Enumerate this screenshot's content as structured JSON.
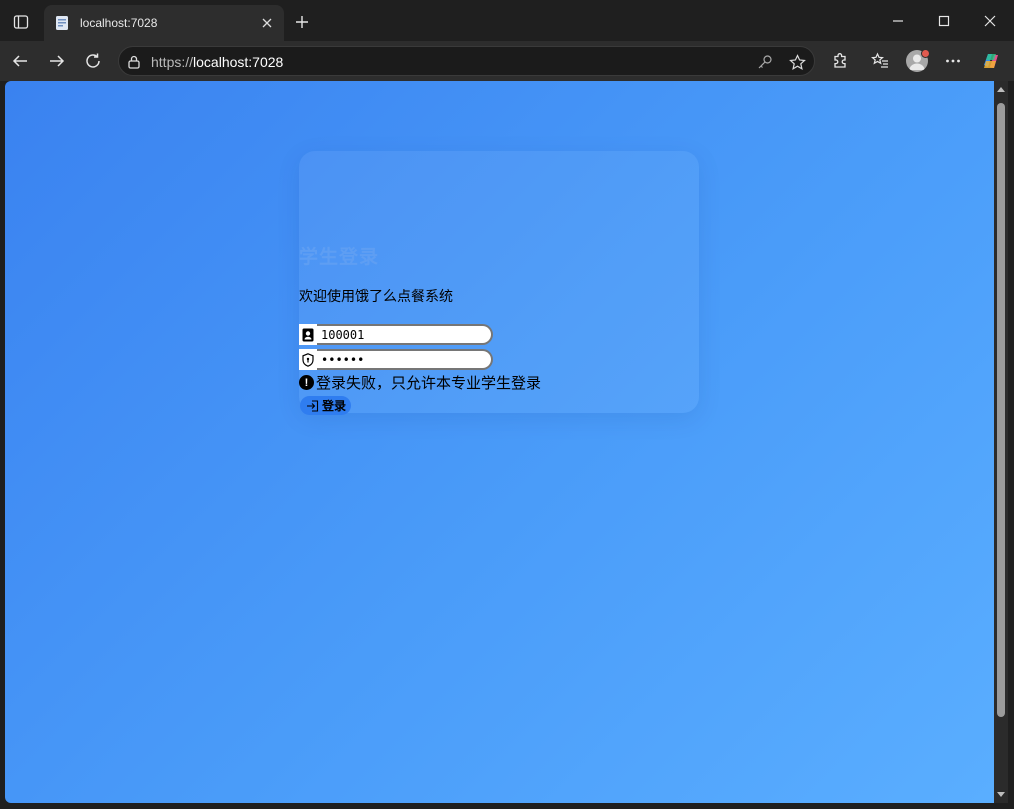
{
  "browser": {
    "tab_title": "localhost:7028",
    "url_scheme": "https://",
    "url_host": "localhost:7028"
  },
  "page": {
    "title": "学生登录",
    "welcome": "欢迎使用饿了么点餐系统",
    "username_value": "100001",
    "password_value": "••••••",
    "error_message": "登录失败，只允许本专业学生登录",
    "error_icon": "!",
    "login_button": "登录"
  },
  "colors": {
    "background_start": "#3a82f0",
    "background_end": "#5aaeff",
    "title": "#5e9ef3",
    "button": "#2f7df0"
  }
}
